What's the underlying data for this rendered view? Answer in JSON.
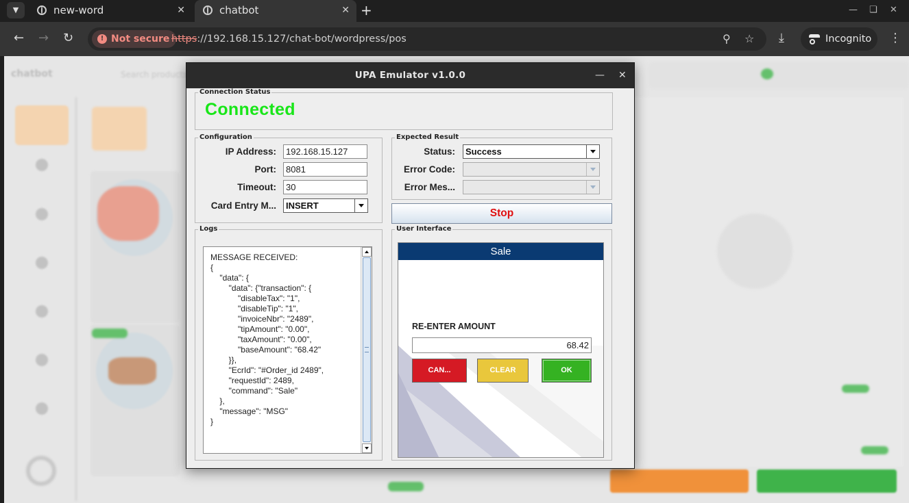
{
  "browser": {
    "tabs": [
      {
        "label": "new-word",
        "active": false
      },
      {
        "label": "chatbot",
        "active": true
      }
    ],
    "security_label": "Not secure",
    "url_scheme": "https",
    "url_rest": "://192.168.15.127/chat-bot/wordpress/pos",
    "incognito_label": "Incognito",
    "icons": [
      "back-arrow-icon",
      "forward-arrow-icon",
      "reload-icon",
      "zoom-icon",
      "star-icon",
      "download-icon",
      "kebab-menu-icon"
    ]
  },
  "background_page": {
    "brand": "chatbot",
    "search_placeholder": "Search products"
  },
  "emulator": {
    "title": "UPA Emulator v1.0.0",
    "connection": {
      "legend": "Connection Status",
      "status": "Connected",
      "status_color": "#19e619"
    },
    "configuration": {
      "legend": "Configuration",
      "ip_label": "IP Address:",
      "ip_value": "192.168.15.127",
      "port_label": "Port:",
      "port_value": "8081",
      "timeout_label": "Timeout:",
      "timeout_value": "30",
      "card_entry_label": "Card Entry M...",
      "card_entry_value": "INSERT"
    },
    "expected_result": {
      "legend": "Expected Result",
      "status_label": "Status:",
      "status_value": "Success",
      "error_code_label": "Error Code:",
      "error_code_value": "",
      "error_message_label": "Error Mes...",
      "error_message_value": ""
    },
    "stop_label": "Stop",
    "stop_color": "#e01010",
    "logs": {
      "legend": "Logs",
      "text": "MESSAGE RECEIVED:\n{\n    \"data\": {\n        \"data\": {\"transaction\": {\n            \"disableTax\": \"1\",\n            \"disableTip\": \"1\",\n            \"invoiceNbr\": \"2489\",\n            \"tipAmount\": \"0.00\",\n            \"taxAmount\": \"0.00\",\n            \"baseAmount\": \"68.42\"\n        }},\n        \"EcrId\": \"#Order_id 2489\",\n        \"requestId\": 2489,\n        \"command\": \"Sale\"\n    },\n    \"message\": \"MSG\"\n}"
    },
    "user_interface": {
      "legend": "User Interface",
      "header": "Sale",
      "header_color": "#0a3a72",
      "prompt": "RE-ENTER AMOUNT",
      "amount": "68.42",
      "cancel_label": "CAN...",
      "clear_label": "CLEAR",
      "ok_label": "OK",
      "cancel_color": "#d51a24",
      "clear_color": "#e9c73c",
      "ok_color": "#35b222"
    }
  }
}
